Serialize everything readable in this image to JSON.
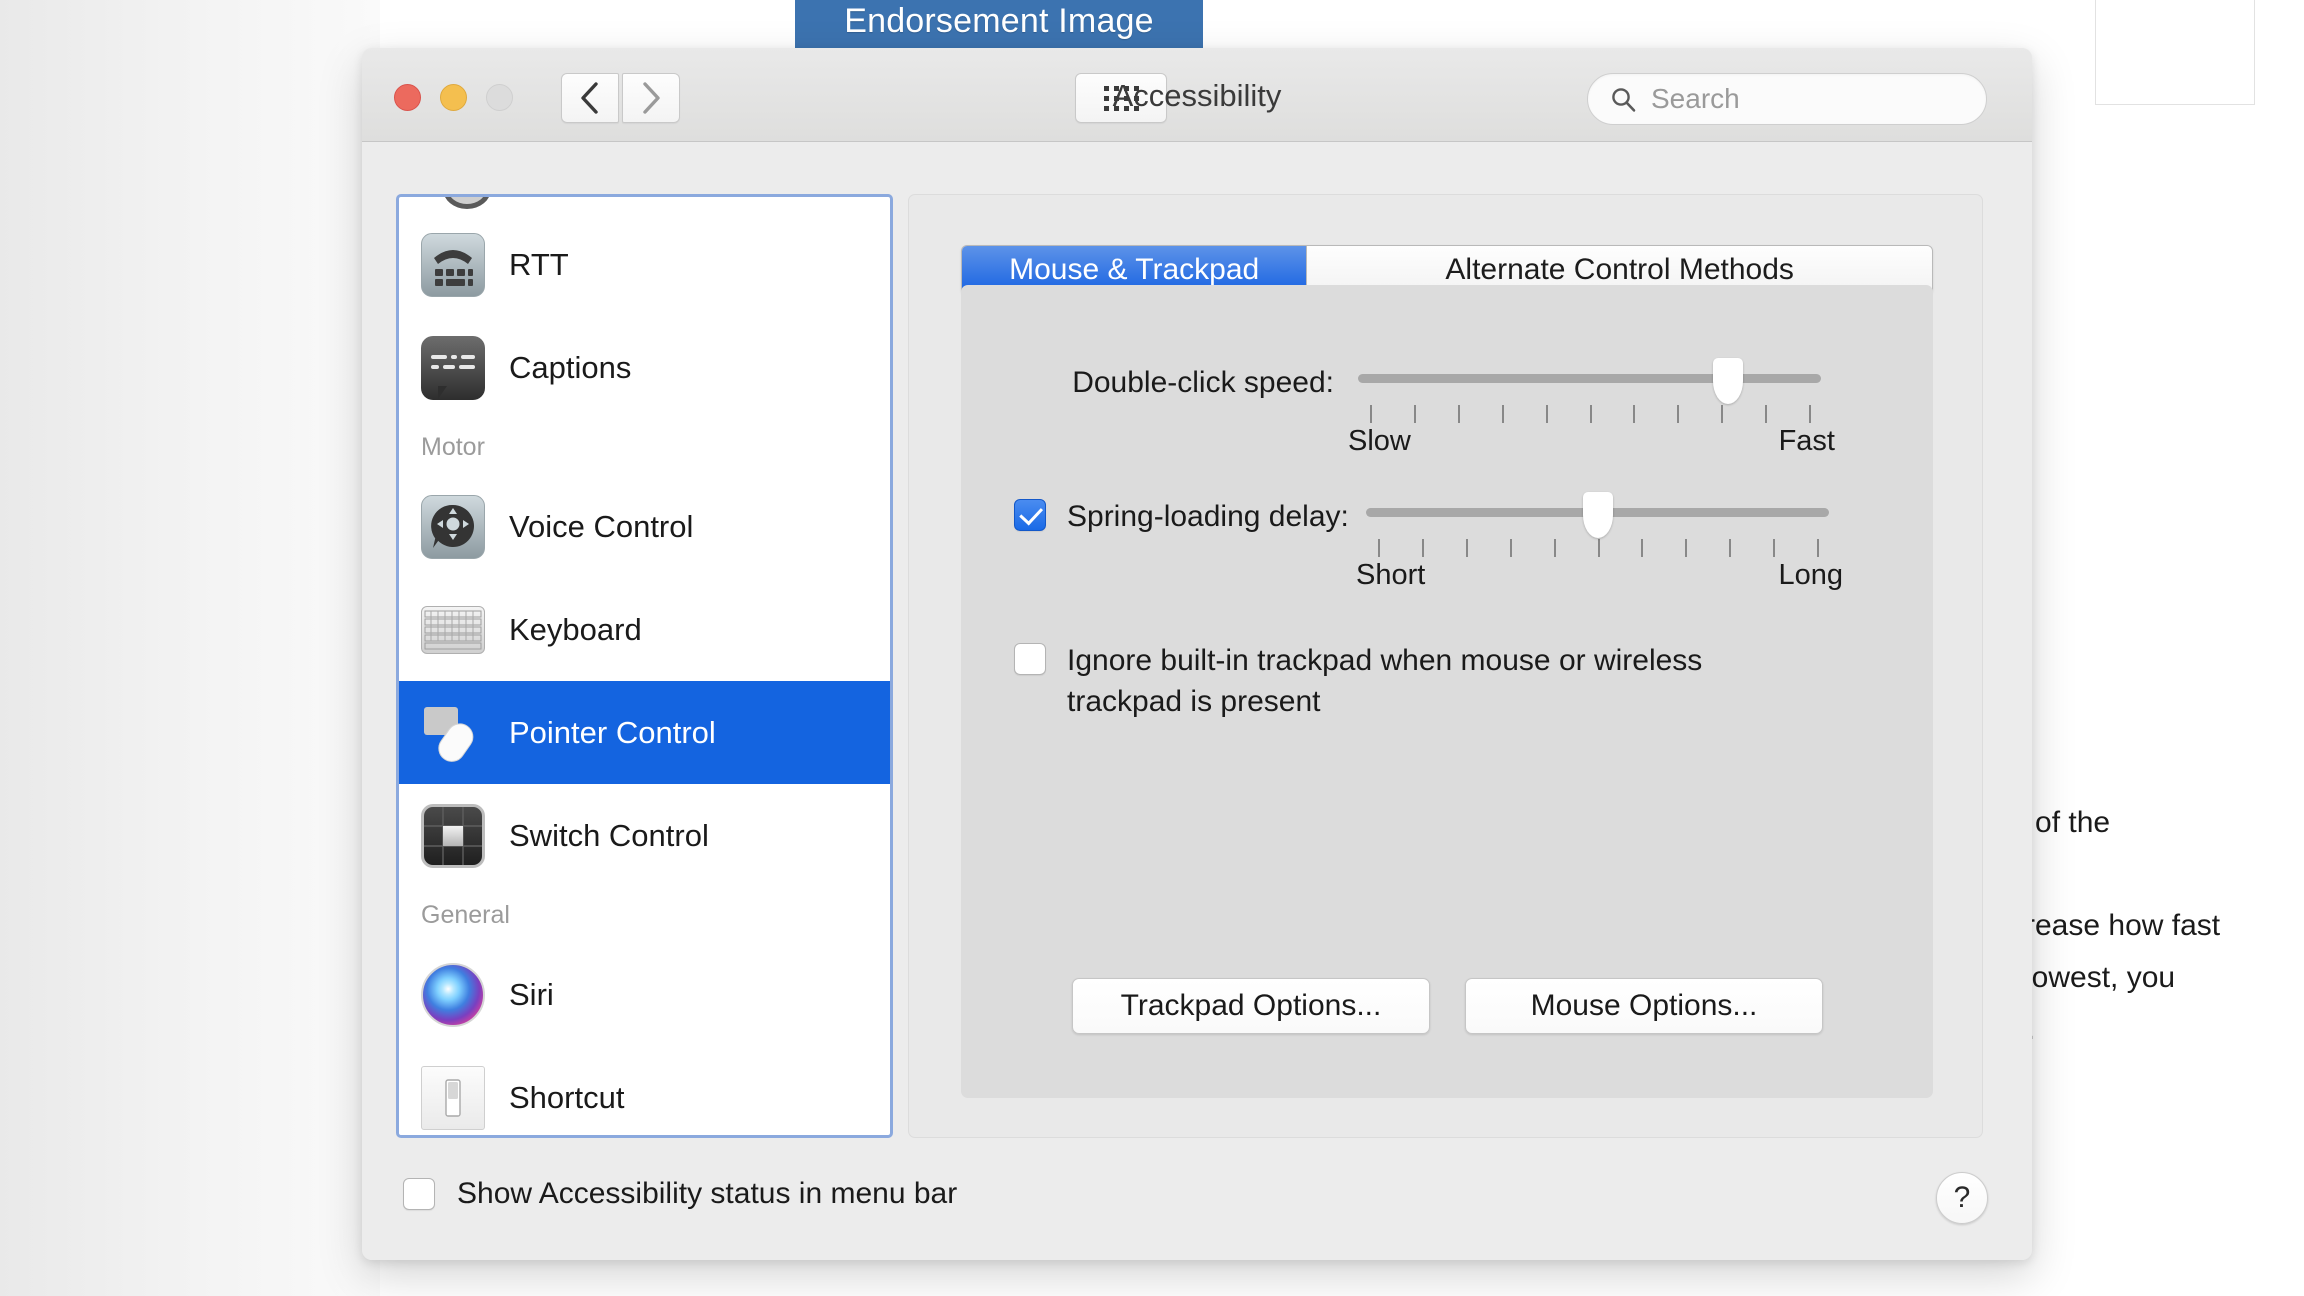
{
  "background": {
    "endorsement_banner": "Endorsement Image",
    "doc_lines": [
      "e of the",
      "crease how fast",
      "slowest, you",
      "g."
    ]
  },
  "window": {
    "title": "Accessibility",
    "traffic_lights": [
      "close-button",
      "minimize-button",
      "zoom-button"
    ],
    "nav": {
      "back_icon": "chevron-left-icon",
      "forward_icon": "chevron-right-icon",
      "grid_icon": "show-all-grid-icon"
    },
    "search": {
      "placeholder": "Search",
      "value": "",
      "icon": "search-icon"
    }
  },
  "sidebar": {
    "items": [
      {
        "label": "RTT",
        "icon": "rtt-icon",
        "group": null,
        "selected": false
      },
      {
        "label": "Captions",
        "icon": "captions-icon",
        "group": null,
        "selected": false
      },
      {
        "label": "Voice Control",
        "icon": "voice-control-icon",
        "group": "Motor",
        "selected": false
      },
      {
        "label": "Keyboard",
        "icon": "keyboard-icon",
        "group": null,
        "selected": false
      },
      {
        "label": "Pointer Control",
        "icon": "pointer-control-icon",
        "group": null,
        "selected": true
      },
      {
        "label": "Switch Control",
        "icon": "switch-control-icon",
        "group": null,
        "selected": false
      },
      {
        "label": "Siri",
        "icon": "siri-icon",
        "group": "General",
        "selected": false
      },
      {
        "label": "Shortcut",
        "icon": "shortcut-icon",
        "group": null,
        "selected": false
      }
    ],
    "groups": {
      "motor": "Motor",
      "general": "General"
    }
  },
  "main": {
    "tabs": [
      {
        "label": "Mouse & Trackpad",
        "active": true
      },
      {
        "label": "Alternate Control Methods",
        "active": false
      }
    ],
    "double_click": {
      "label": "Double-click speed:",
      "min_label": "Slow",
      "max_label": "Fast",
      "tick_count": 11,
      "value_index": 9,
      "value_percent": 80
    },
    "spring_loading": {
      "label": "Spring-loading delay:",
      "checked": true,
      "min_label": "Short",
      "max_label": "Long",
      "tick_count": 11,
      "value_index": 6,
      "value_percent": 50
    },
    "ignore_trackpad": {
      "label": "Ignore built-in trackpad when mouse or wireless trackpad is present",
      "checked": false
    },
    "buttons": {
      "trackpad_options": "Trackpad Options...",
      "mouse_options": "Mouse Options..."
    }
  },
  "footer": {
    "show_status": {
      "label": "Show Accessibility status in menu bar",
      "checked": false
    },
    "help_label": "?"
  },
  "colors": {
    "accent_blue": "#1464e0",
    "tab_blue": "#1863e2",
    "banner_blue": "#3c73b0",
    "sidebar_focus_ring": "#8ba9de",
    "window_bg": "#ececec",
    "panel_bg": "#dcdcdc"
  }
}
